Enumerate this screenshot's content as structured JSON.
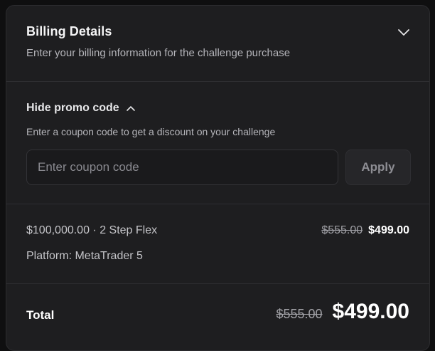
{
  "billing": {
    "title": "Billing Details",
    "subtitle": "Enter your billing information for the challenge purchase"
  },
  "promo": {
    "toggle_label": "Hide promo code",
    "description": "Enter a coupon code to get a discount on your challenge",
    "input_placeholder": "Enter coupon code",
    "input_value": "",
    "apply_label": "Apply"
  },
  "order": {
    "item_name": "$100,000.00 · 2 Step Flex",
    "original_price": "$555.00",
    "discounted_price": "$499.00",
    "platform": "Platform: MetaTrader 5"
  },
  "total": {
    "label": "Total",
    "original_price": "$555.00",
    "final_price": "$499.00"
  },
  "icons": {
    "collapse_billing": "chevron-down-icon",
    "hide_promo": "chevron-up-icon"
  },
  "colors": {
    "background": "#0f0f10",
    "card": "#1e1e20",
    "divider": "#2e2e31",
    "text_primary": "#ffffff",
    "text_secondary": "#b5b5ba"
  }
}
